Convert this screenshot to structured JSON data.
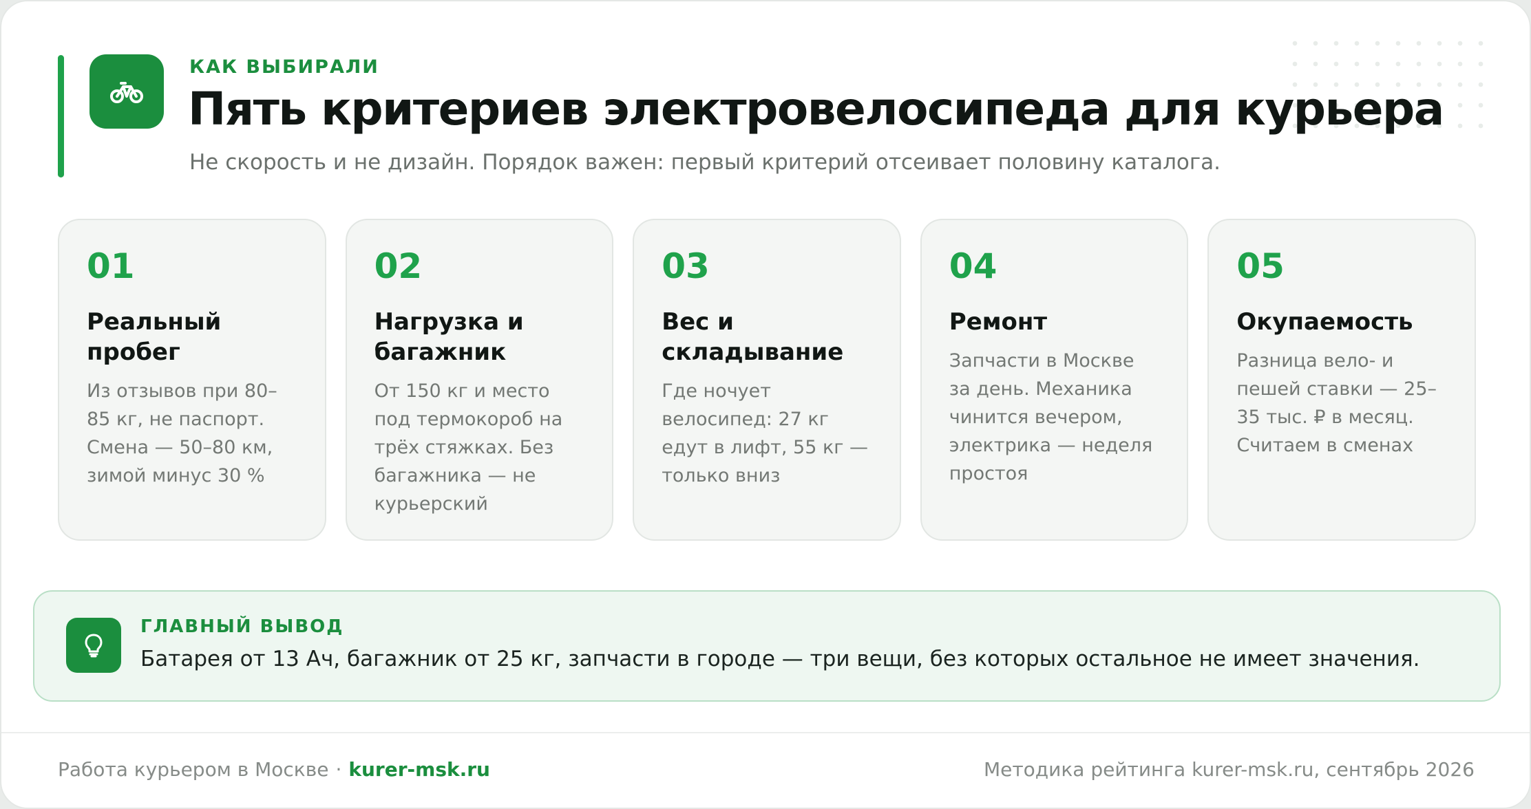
{
  "header": {
    "eyebrow": "КАК ВЫБИРАЛИ",
    "title": "Пять критериев электровелосипеда для курьера",
    "subtitle": "Не скорость и не дизайн. Порядок важен: первый критерий отсеивает половину каталога.",
    "logo_icon": "bicycle-icon"
  },
  "criteria": [
    {
      "number": "01",
      "title": "Реальный пробег",
      "text": "Из отзывов при 80–85 кг, не паспорт. Смена — 50–80 км, зимой минус 30 %"
    },
    {
      "number": "02",
      "title": "Нагрузка и багажник",
      "text": "От 150 кг и место под термокороб на трёх стяжках. Без багажника — не курьерский"
    },
    {
      "number": "03",
      "title": "Вес и складывание",
      "text": "Где ночует велосипед: 27 кг едут в лифт, 55 кг — только вниз"
    },
    {
      "number": "04",
      "title": "Ремонт",
      "text": "Запчасти в Москве за день. Механика чинится вечером, электрика — неделя простоя"
    },
    {
      "number": "05",
      "title": "Окупаемость",
      "text": "Разница вело- и пешей ставки — 25–35 тыс. ₽ в месяц. Считаем в сменах"
    }
  ],
  "takeaway": {
    "label": "ГЛАВНЫЙ ВЫВОД",
    "text": "Батарея от 13 Ач, багажник от 25 кг, запчасти в городе — три вещи, без которых остальное не имеет значения.",
    "icon": "lightbulb-icon"
  },
  "footer": {
    "left_text": "Работа курьером в Москве",
    "separator": "·",
    "link_text": "kurer-msk.ru",
    "right_text": "Методика рейтинга kurer-msk.ru, сентябрь 2026"
  },
  "colors": {
    "accent": "#1fa24b",
    "accent_dark": "#1b8e3e",
    "title": "#111714",
    "muted": "#6b716d",
    "card_bg": "#f4f6f4",
    "takeaway_bg": "#eef7f1"
  }
}
